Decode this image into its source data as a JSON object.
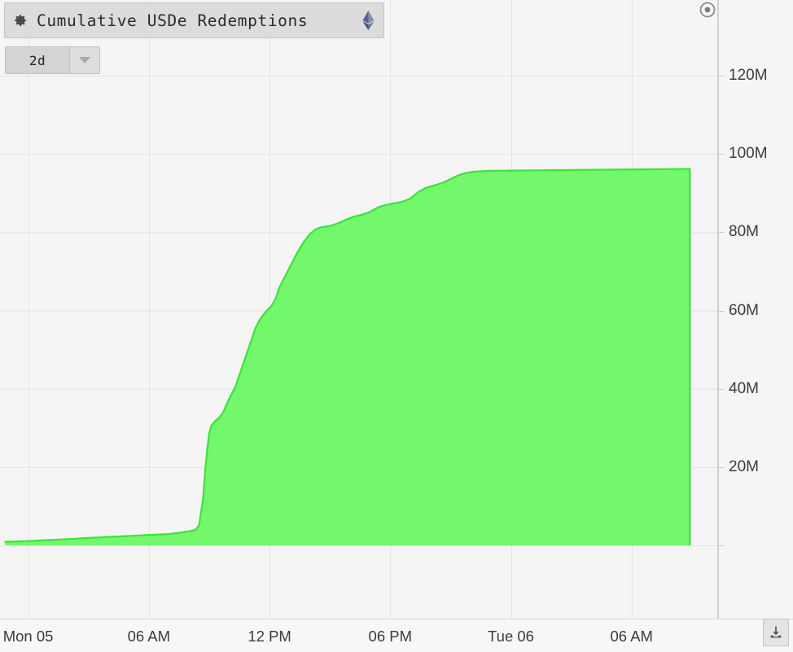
{
  "widget": {
    "title": "Cumulative USDe Redemptions",
    "gear_icon": "gear-icon",
    "chain_icon": "ethereum-diamond-icon",
    "record_icon": "record-target-icon"
  },
  "range_selector": {
    "value": "2d",
    "caret_icon": "chevron-down-icon"
  },
  "download": {
    "label": "Download",
    "icon": "download-icon"
  },
  "colors": {
    "area_fill": "#73f76b",
    "line_stroke": "#3fe03f",
    "background": "#f5f5f5",
    "gridline": "#e3e3e3",
    "axis_line": "#cfcfcf",
    "tick_text": "#3b3b3b",
    "widget_bg": "#dcdcdc",
    "eth_purple": "#62688f"
  },
  "chart_data": {
    "type": "area",
    "title": "Cumulative USDe Redemptions",
    "xlabel": "",
    "ylabel": "",
    "grid": true,
    "legend": "none",
    "series_name": "Cumulative USDe Redemptions",
    "y_ticks": [
      "20M",
      "40M",
      "60M",
      "80M",
      "100M",
      "120M"
    ],
    "y_tick_values": [
      20000000,
      40000000,
      60000000,
      80000000,
      100000000,
      120000000
    ],
    "ylim": [
      0,
      132000000
    ],
    "x_ticks": [
      "Mon 05",
      "06 AM",
      "12 PM",
      "06 PM",
      "Tue 06",
      "06 AM"
    ],
    "x_tick_hours": [
      0,
      6,
      12,
      18,
      24,
      30
    ],
    "xlim_hours": [
      -1.4,
      34.3
    ],
    "x": [
      -1.15,
      0,
      1.0,
      2.0,
      3.0,
      4.0,
      5.0,
      6.0,
      7.0,
      7.5,
      8.0,
      8.3,
      8.5,
      8.7,
      8.8,
      8.9,
      9.0,
      9.1,
      9.3,
      9.5,
      9.7,
      9.9,
      10.1,
      10.3,
      10.5,
      10.7,
      10.9,
      11.1,
      11.3,
      11.5,
      11.7,
      11.9,
      12.1,
      12.3,
      12.5,
      12.8,
      13.1,
      13.4,
      13.7,
      14.0,
      14.3,
      14.6,
      15.0,
      15.4,
      15.8,
      16.2,
      16.6,
      17.0,
      17.4,
      17.8,
      18.2,
      18.6,
      19.0,
      19.4,
      19.8,
      20.2,
      20.6,
      21.0,
      21.4,
      21.8,
      22.2,
      22.6,
      23.0,
      24.0,
      25.0,
      26.0,
      27.0,
      28.0,
      29.0,
      30.0,
      31.0,
      32.0,
      32.9
    ],
    "y": [
      900000,
      1100000,
      1350000,
      1600000,
      1900000,
      2150000,
      2400000,
      2650000,
      2900000,
      3200000,
      3600000,
      3900000,
      5200000,
      12000000,
      19000000,
      24500000,
      28500000,
      30500000,
      31800000,
      32600000,
      34000000,
      36500000,
      38500000,
      40500000,
      43500000,
      46500000,
      49500000,
      52500000,
      55500000,
      57500000,
      59000000,
      60200000,
      61200000,
      63000000,
      66000000,
      69000000,
      72000000,
      75000000,
      77500000,
      79500000,
      80800000,
      81300000,
      81600000,
      82300000,
      83200000,
      84000000,
      84500000,
      85200000,
      86400000,
      87000000,
      87400000,
      87800000,
      88600000,
      90300000,
      91400000,
      92000000,
      92600000,
      93600000,
      94600000,
      95200000,
      95500000,
      95600000,
      95700000,
      95750000,
      95800000,
      95850000,
      95900000,
      95950000,
      96000000,
      96050000,
      96100000,
      96150000,
      96200000
    ],
    "final_value": 96200000,
    "final_value_label": "~96M"
  }
}
